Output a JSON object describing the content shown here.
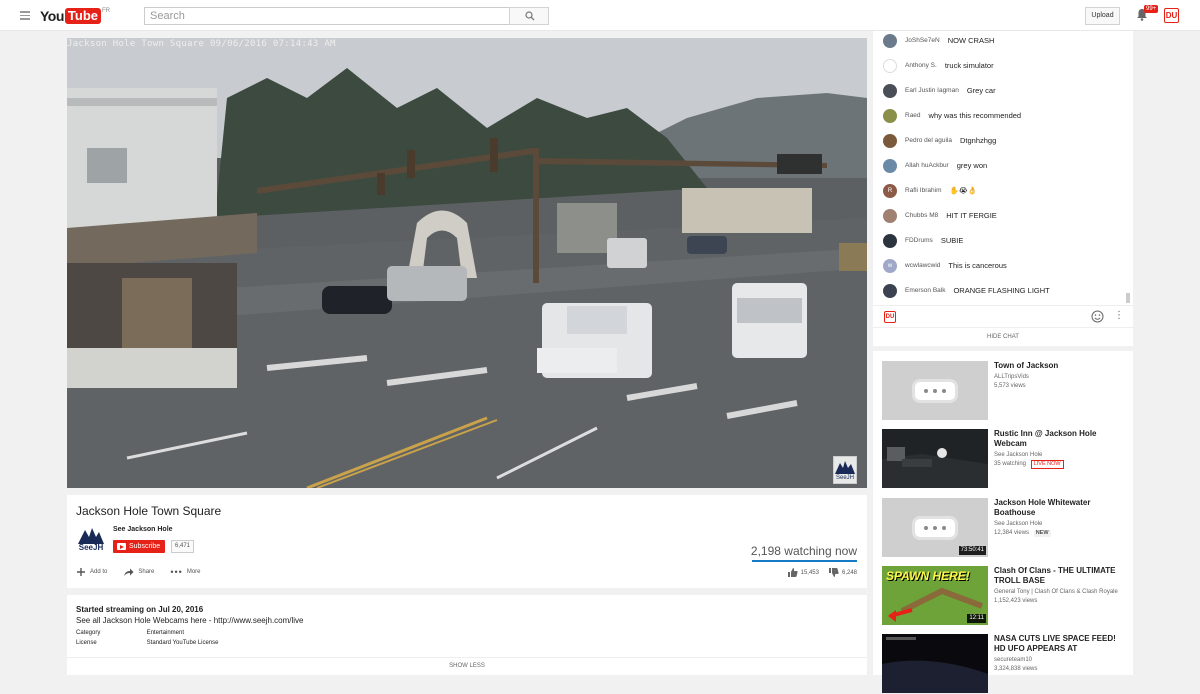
{
  "header": {
    "logo_you": "You",
    "logo_tube": "Tube",
    "logo_region": "FR",
    "search_placeholder": "Search",
    "upload_label": "Upload",
    "notification_count": "99+",
    "avatar_initials": "DU"
  },
  "video": {
    "overlay_text": "Jackson Hole Town Square 09/06/2016 07:14:43 AM",
    "watermark": "SeeJH"
  },
  "info": {
    "title": "Jackson Hole Town Square",
    "channel_name": "See Jackson Hole",
    "channel_logo_text": "SeeJH",
    "subscribe_label": "Subscribe",
    "subscriber_count": "6,471",
    "watching": "2,198 watching now",
    "add_to": "Add to",
    "share": "Share",
    "more": "More",
    "likes": "15,453",
    "dislikes": "6,248"
  },
  "description": {
    "started": "Started streaming on Jul 20, 2016",
    "text": "See all Jackson Hole Webcams here - http://www.seejh.com/live",
    "category_label": "Category",
    "category_value": "Entertainment",
    "license_label": "License",
    "license_value": "Standard YouTube License",
    "show_less": "SHOW LESS"
  },
  "chat": {
    "messages": [
      {
        "author": "JoShSe7eN",
        "text": "NOW CRASH",
        "color": "#6b7b8c",
        "initial": ""
      },
      {
        "author": "Anthony S.",
        "text": "truck simulator",
        "color": "#ffffff",
        "initial": ""
      },
      {
        "author": "Earl Justin Iagman",
        "text": "Grey car",
        "color": "#4a4f57",
        "initial": ""
      },
      {
        "author": "Raed",
        "text": "why was this recommended",
        "color": "#8a8f4a",
        "initial": ""
      },
      {
        "author": "Pedro del aguila",
        "text": "Dtgnhzhgg",
        "color": "#7a5a3a",
        "initial": ""
      },
      {
        "author": "Allah huAckbur",
        "text": "grey won",
        "color": "#6a8aa8",
        "initial": ""
      },
      {
        "author": "Rafli Ibrahim",
        "text": "✋😭👌",
        "color": "#8d5a47",
        "initial": "R"
      },
      {
        "author": "Chubbs M8",
        "text": "HIT IT FERGIE",
        "color": "#a08070",
        "initial": ""
      },
      {
        "author": "FDDrums",
        "text": "SUBIE",
        "color": "#2c3440",
        "initial": ""
      },
      {
        "author": "wcwlawcwid",
        "text": "This is cancerous",
        "color": "#9fa8c8",
        "initial": "w"
      },
      {
        "author": "Emerson Balk",
        "text": "ORANGE FLASHING LIGHT",
        "color": "#3c4250",
        "initial": ""
      }
    ],
    "user_initials": "DU",
    "hide_chat": "HIDE CHAT"
  },
  "sidebar": {
    "items": [
      {
        "title": "Town of Jackson",
        "channel": "ALLTripsVids",
        "meta": "5,573 views",
        "badge": "",
        "duration": ""
      },
      {
        "title": "Rustic Inn @ Jackson Hole Webcam",
        "channel": "See Jackson Hole",
        "meta": "35 watching",
        "badge": "LIVE NOW",
        "duration": ""
      },
      {
        "title": "Jackson Hole Whitewater Boathouse",
        "channel": "See Jackson Hole",
        "meta": "12,384 views",
        "badge": "NEW",
        "duration": "73:50:41"
      },
      {
        "title": "Clash Of Clans - THE ULTIMATE TROLL BASE",
        "channel": "General Tony | Clash Of Clans & Clash Royale",
        "meta": "1,152,423 views",
        "badge": "",
        "duration": "12:11",
        "thumb_text": "SPAWN HERE!"
      },
      {
        "title": "NASA CUTS LIVE SPACE FEED! HD UFO APPEARS AT",
        "channel": "secureteam10",
        "meta": "3,324,838 views",
        "badge": "",
        "duration": ""
      }
    ]
  }
}
